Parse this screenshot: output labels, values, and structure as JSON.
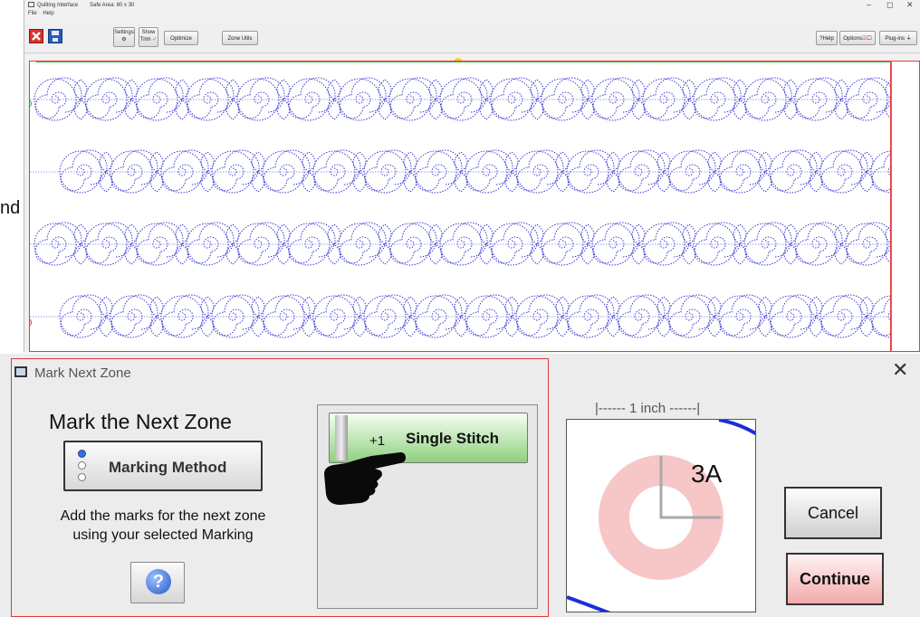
{
  "window": {
    "title": "Quilting Interface",
    "safe_area": "Safe Area: 80 x 30",
    "minimize": "–",
    "maximize": "◻",
    "close": "✕"
  },
  "menu": [
    "File",
    "Help"
  ],
  "toolbar": {
    "settings_label": "Settings",
    "show_trim_label": "Show Trim",
    "optimize_label": "Optimize",
    "zone_utils_label": "Zone Utils",
    "help_label": "?Help",
    "options_label": "Options",
    "plugins_label": "Plug-ins"
  },
  "edge_fragment": "nd",
  "dialog": {
    "title": "Mark Next Zone",
    "close": "✕",
    "heading": "Mark the Next Zone",
    "method_button": "Marking Method",
    "instructions_line1": "Add the marks for the next zone",
    "instructions_line2": "using your selected Marking",
    "help_glyph": "?",
    "stitch_button": "Single Stitch",
    "stitch_increment": "+1",
    "scale_label": "|------ 1 inch ------|",
    "preview_code": "3A",
    "cancel_button": "Cancel",
    "continue_button": "Continue"
  },
  "colors": {
    "pattern_stroke": "#3a3ad6",
    "frame_red": "#e03a3a",
    "frame_green": "#4caf50",
    "marker_yellow": "#f0d81e",
    "ring_pink": "#f7c6c6",
    "stitch_green": "#8fd07f",
    "continue_pink": "#f3a9a9"
  }
}
